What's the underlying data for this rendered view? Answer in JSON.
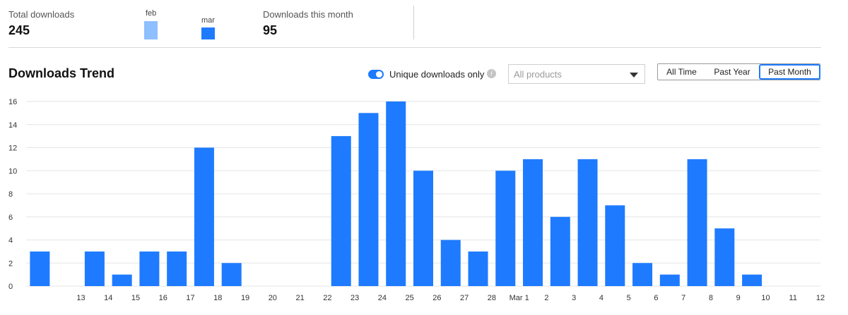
{
  "summary": {
    "total_label": "Total downloads",
    "total_value": "245",
    "month_label": "Downloads this month",
    "month_value": "95"
  },
  "legend": [
    {
      "label": "feb",
      "color": "#8ebfff"
    },
    {
      "label": "mar",
      "color": "#1e7bff"
    }
  ],
  "trend": {
    "title": "Downloads Trend",
    "toggle_label": "Unique downloads only",
    "toggle_on": true,
    "info_icon": "i",
    "product_placeholder": "All products",
    "ranges": [
      "All Time",
      "Past Year",
      "Past Month"
    ],
    "active_range": "Past Month"
  },
  "chart_data": {
    "type": "bar",
    "categories": [
      "12",
      "13",
      "14",
      "15",
      "16",
      "17",
      "18",
      "19",
      "20",
      "21",
      "22",
      "23",
      "24",
      "25",
      "26",
      "27",
      "28",
      "Mar 1",
      "2",
      "3",
      "4",
      "5",
      "6",
      "7",
      "8",
      "9",
      "10",
      "11",
      "12"
    ],
    "values": [
      3,
      0,
      3,
      1,
      3,
      3,
      12,
      2,
      0,
      0,
      0,
      13,
      15,
      16,
      10,
      4,
      3,
      10,
      11,
      6,
      11,
      7,
      2,
      1,
      11,
      5,
      1,
      0,
      0
    ],
    "tick_labels": [
      "",
      "13",
      "14",
      "15",
      "16",
      "17",
      "18",
      "19",
      "20",
      "21",
      "22",
      "23",
      "24",
      "25",
      "26",
      "27",
      "28",
      "Mar 1",
      "2",
      "3",
      "4",
      "5",
      "6",
      "7",
      "8",
      "9",
      "10",
      "11",
      "12"
    ],
    "yticks": [
      0,
      2,
      4,
      6,
      8,
      10,
      12,
      14,
      16
    ],
    "ylim": [
      0,
      16
    ],
    "bar_color": "#1e7bff",
    "grid": true
  }
}
